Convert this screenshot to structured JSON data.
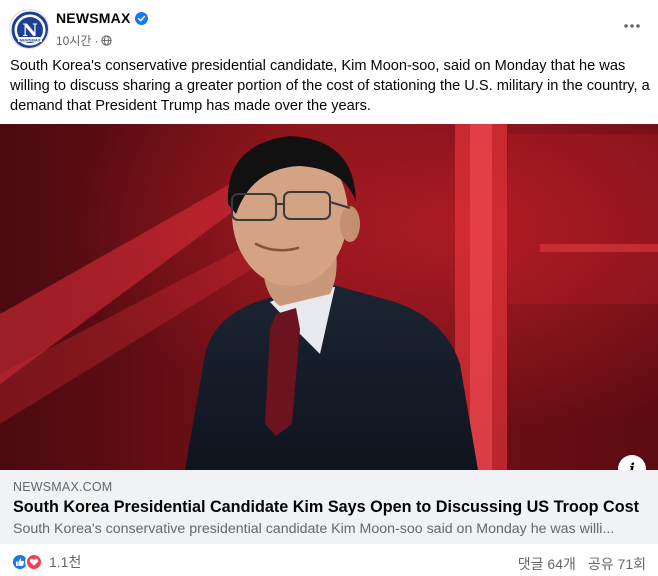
{
  "post": {
    "page_name": "NEWSMAX",
    "timestamp": "10시간",
    "separator": "·",
    "caption": "South Korea's conservative presidential candidate, Kim Moon-soo, said on Monday that he was willing to discuss sharing a greater portion of the cost of stationing the U.S. military in the country, a demand that President Trump has made over the years."
  },
  "avatar": {
    "logo_text": "N",
    "logo_sub": "NEWSMAX",
    "brand_color": "#1c3f8f"
  },
  "icons": {
    "verified": "verified-badge-icon",
    "privacy": "globe-icon",
    "more": "more-options-icon",
    "info": "info-icon",
    "like": "like-icon",
    "love": "love-icon"
  },
  "link_preview": {
    "domain": "NEWSMAX.COM",
    "title": "South Korea Presidential Candidate Kim Says Open to Discussing US Troop Cost",
    "description": "South Korea's conservative presidential candidate Kim Moon-soo said on Monday he was willi..."
  },
  "info_button": {
    "label": "i"
  },
  "engagement": {
    "reaction_count": "1.1천",
    "comments": "댓글 64개",
    "shares": "공유 71회"
  },
  "colors": {
    "facebook_blue": "#1877f2",
    "love_red": "#f33e58",
    "secondary_text": "#65676b",
    "preview_bg": "#f0f2f5"
  }
}
